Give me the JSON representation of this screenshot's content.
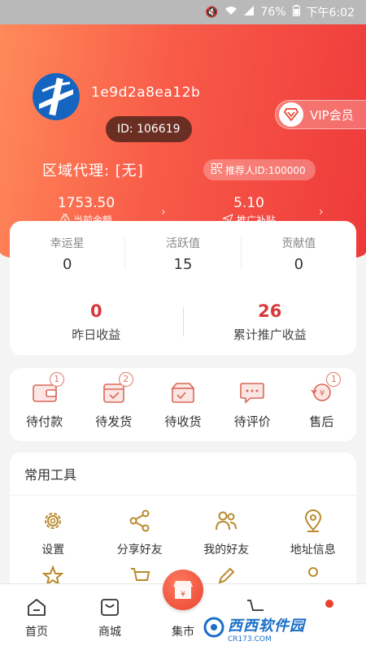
{
  "status_bar": {
    "battery": "76%",
    "time": "下午6:02"
  },
  "profile": {
    "username": "1e9d2a8ea12b",
    "id_label": "ID: 106619",
    "vip_label": "VIP会员",
    "region_label": "区域代理: [无]",
    "referrer_label": "推荐人ID:100000"
  },
  "summary": [
    {
      "value": "1753.50",
      "label": "当前余额"
    },
    {
      "value": "5.10",
      "label": "推广补贴"
    }
  ],
  "stats": [
    {
      "label": "幸运星",
      "value": "0"
    },
    {
      "label": "活跃值",
      "value": "15"
    },
    {
      "label": "贡献值",
      "value": "0"
    }
  ],
  "earnings": [
    {
      "value": "0",
      "label": "昨日收益"
    },
    {
      "value": "26",
      "label": "累计推广收益"
    }
  ],
  "orders": [
    {
      "label": "待付款",
      "badge": "1"
    },
    {
      "label": "待发货",
      "badge": "2"
    },
    {
      "label": "待收货",
      "badge": ""
    },
    {
      "label": "待评价",
      "badge": ""
    },
    {
      "label": "售后",
      "badge": "1"
    }
  ],
  "tools": {
    "title": "常用工具",
    "items": [
      {
        "label": "设置",
        "icon": "gear-icon"
      },
      {
        "label": "分享好友",
        "icon": "share-icon"
      },
      {
        "label": "我的好友",
        "icon": "friends-icon"
      },
      {
        "label": "地址信息",
        "icon": "location-icon"
      }
    ]
  },
  "bottom_nav": [
    {
      "label": "首页",
      "icon": "home-icon"
    },
    {
      "label": "商城",
      "icon": "shop-icon"
    },
    {
      "label": "集市",
      "icon": "market-icon"
    }
  ],
  "watermark": {
    "text": "西西软件园",
    "sub": "CR173.COM"
  },
  "colors": {
    "accent": "#d8383a",
    "icon_gold": "#b98a2e",
    "header_start": "#ff8a5a",
    "header_end": "#ee3a3a"
  }
}
